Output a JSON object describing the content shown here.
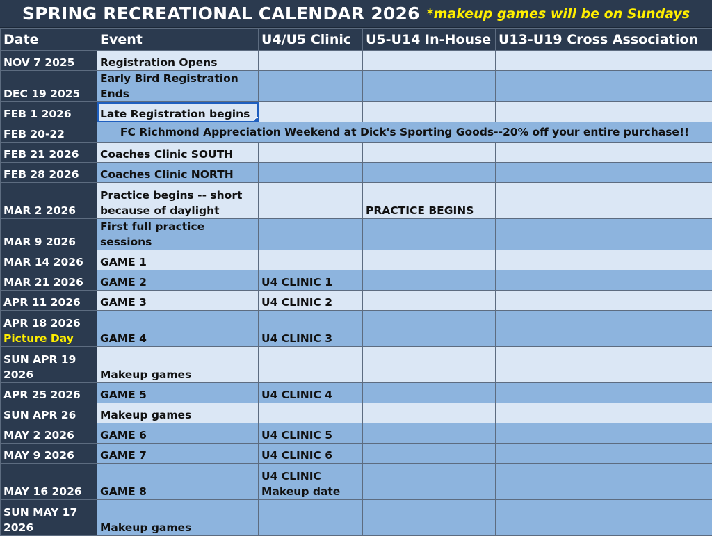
{
  "header": {
    "title": "SPRING RECREATIONAL CALENDAR 2026",
    "note": "*makeup games will be on Sundays"
  },
  "columns": [
    "Date",
    "Event",
    "U4/U5 Clinic",
    "U5-U14 In-House",
    "U13-U19 Cross Association"
  ],
  "rows": [
    {
      "date": "NOV 7 2025",
      "event": "Registration Opens",
      "u4": "",
      "inhouse": "",
      "cross": ""
    },
    {
      "date": "DEC 19 2025",
      "event": "Early Bird Registration Ends",
      "u4": "",
      "inhouse": "",
      "cross": ""
    },
    {
      "date": "FEB 1 2026",
      "event": "Late Registration begins",
      "u4": "",
      "inhouse": "",
      "cross": ""
    },
    {
      "date": "FEB 20-22",
      "banner": "FC Richmond Appreciation Weekend at Dick's Sporting Goods--20% off your entire purchase!!"
    },
    {
      "date": "FEB 21 2026",
      "event": "Coaches Clinic SOUTH",
      "u4": "",
      "inhouse": "",
      "cross": ""
    },
    {
      "date": "FEB 28 2026",
      "event": "Coaches Clinic NORTH",
      "u4": "",
      "inhouse": "",
      "cross": ""
    },
    {
      "date": "MAR 2 2026",
      "event": "Practice begins -- short because of daylight",
      "u4": "",
      "inhouse": "PRACTICE BEGINS",
      "cross": ""
    },
    {
      "date": "MAR 9 2026",
      "event": "First full practice sessions",
      "u4": "",
      "inhouse": "",
      "cross": ""
    },
    {
      "date": "MAR 14 2026",
      "event": "GAME 1",
      "u4": "",
      "inhouse": "",
      "cross": ""
    },
    {
      "date": "MAR 21 2026",
      "event": "GAME 2",
      "u4": "U4 CLINIC 1",
      "inhouse": "",
      "cross": ""
    },
    {
      "date": "APR 11 2026",
      "event": "GAME 3",
      "u4": "U4 CLINIC 2",
      "inhouse": "",
      "cross": ""
    },
    {
      "date": "APR 18 2026",
      "date_note": "Picture Day",
      "event": "GAME 4",
      "u4": "U4 CLINIC 3",
      "inhouse": "",
      "cross": ""
    },
    {
      "date": "SUN APR 19 2026",
      "event": "Makeup games",
      "u4": "",
      "inhouse": "",
      "cross": ""
    },
    {
      "date": "APR 25 2026",
      "event": "GAME 5",
      "u4": "U4 CLINIC 4",
      "inhouse": "",
      "cross": ""
    },
    {
      "date": "SUN APR 26",
      "event": "Makeup games",
      "u4": "",
      "inhouse": "",
      "cross": ""
    },
    {
      "date": "MAY 2 2026",
      "event": "GAME 6",
      "u4": "U4 CLINIC 5",
      "inhouse": "",
      "cross": ""
    },
    {
      "date": "MAY 9 2026",
      "event": "GAME 7",
      "u4": "U4 CLINIC 6",
      "inhouse": "",
      "cross": ""
    },
    {
      "date": "MAY 16 2026",
      "event": "GAME 8",
      "u4": "U4 CLINIC Makeup date",
      "inhouse": "",
      "cross": ""
    },
    {
      "date": "SUN MAY 17 2026",
      "event": "Makeup games",
      "u4": "",
      "inhouse": "",
      "cross": ""
    }
  ]
}
